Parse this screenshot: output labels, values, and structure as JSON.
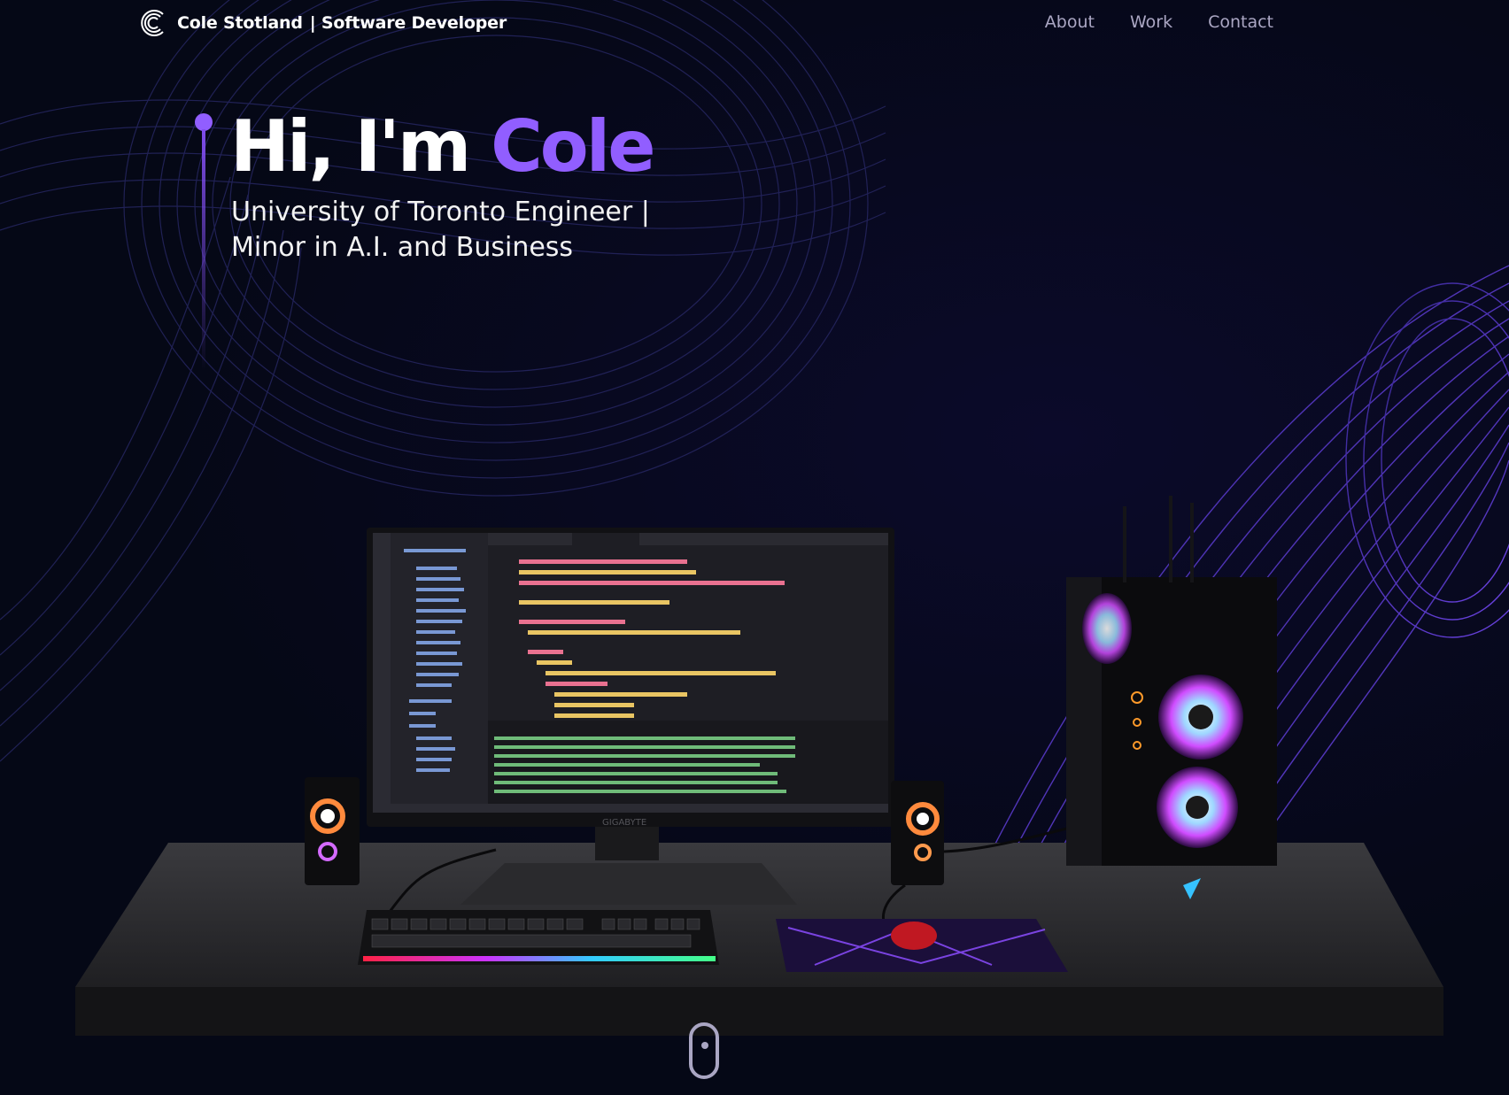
{
  "header": {
    "brand_name": "Cole Stotland",
    "brand_tagline": "| Software Developer",
    "nav": [
      {
        "label": "About"
      },
      {
        "label": "Work"
      },
      {
        "label": "Contact"
      }
    ]
  },
  "hero": {
    "greeting": "Hi, I'm ",
    "name": "Cole",
    "subtitle_line1": "University of Toronto Engineer |",
    "subtitle_line2": "Minor in A.I. and Business"
  },
  "scene": {
    "monitor_brand": "GIGABYTE"
  },
  "colors": {
    "background": "#050816",
    "accent": "#915eff",
    "nav_text": "#aaa6c3"
  }
}
